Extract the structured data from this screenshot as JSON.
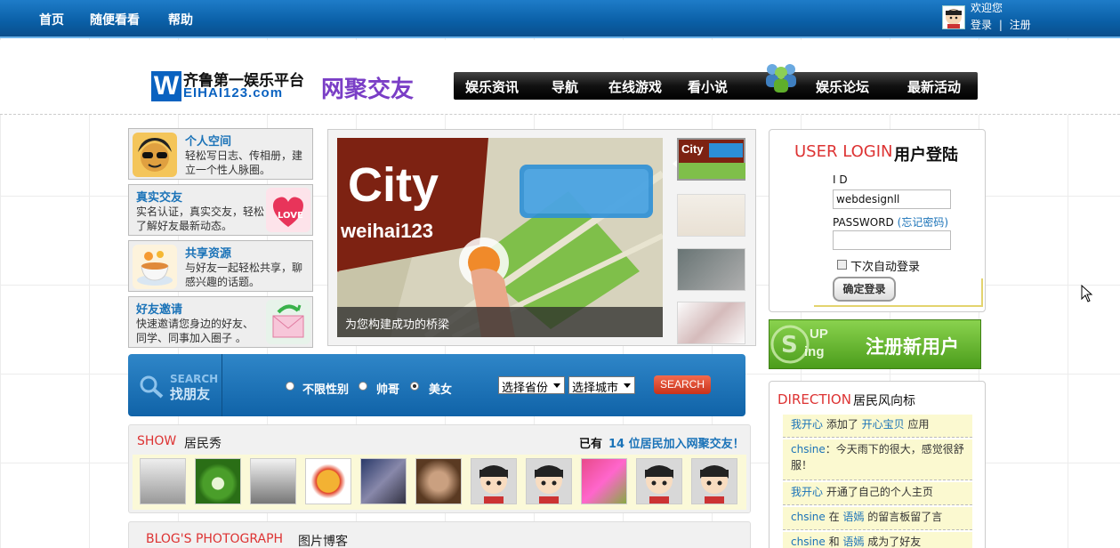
{
  "topbar": {
    "nav": [
      "首页",
      "随便看看",
      "帮助"
    ],
    "welcome": "欢迎您",
    "login_link": "登录",
    "separator": "|",
    "register_link": "注册"
  },
  "header": {
    "logo_mark": "W",
    "logo_cn": "齐鲁第一娱乐平台",
    "logo_en": "EIHAI123.com",
    "logo2": "网聚交友",
    "nav": [
      "娱乐资讯",
      "导航",
      "在线游戏",
      "看小说",
      "娱乐论坛",
      "最新活动"
    ]
  },
  "features": [
    {
      "title": "个人空间",
      "desc": "轻松写日志、传相册，建立一个性人脉圈。",
      "icon": "sunglasses-face-icon"
    },
    {
      "title": "真实交友",
      "desc": "实名认证，真实交友，轻松了解好友最新动态。",
      "icon": "love-heart-icon"
    },
    {
      "title": "共享资源",
      "desc": "与好友一起轻松共享，聊感兴趣的话题。",
      "icon": "tea-cup-icon"
    },
    {
      "title": "好友邀请",
      "desc": "快速邀请您身边的好友、同学、同事加入圈子 。",
      "icon": "invite-envelope-icon"
    }
  ],
  "slideshow": {
    "title_word": "City",
    "title_sub": "weihai123",
    "caption": "为您构建成功的桥梁"
  },
  "search": {
    "label_en": "SEARCH",
    "label_cn": "找朋友",
    "genders": [
      "不限性别",
      "帅哥",
      "美女"
    ],
    "selected_gender": "美女",
    "province": "选择省份",
    "city": "选择城市",
    "button": "SEARCH"
  },
  "show": {
    "title_en": "SHOW",
    "title_cn": "居民秀",
    "count_prefix": "已有",
    "count_text": "14 位居民加入网聚交友！"
  },
  "blog": {
    "title_en": "BLOG'S PHOTOGRAPH",
    "title_cn": "图片博客"
  },
  "login": {
    "title_en": "USER LOGIN",
    "title_cn": "用户登陆",
    "id_label": "I D",
    "id_value": "webdesignll",
    "password_label": "PASSWORD",
    "forgot": "(忘记密码)",
    "remember": "下次自动登录",
    "submit": "确定登录"
  },
  "register": {
    "label": "注册新用户",
    "logo_text_1": "UP",
    "logo_text_2": "ing"
  },
  "direction": {
    "title_en": "DIRECTION",
    "title_cn": "居民风向标",
    "items": [
      {
        "user": "我开心",
        "text": " 添加了 ",
        "target": "开心宝贝",
        "tail": " 应用"
      },
      {
        "user": "chsine",
        "text": "：今天雨下的很大，感觉很舒服！",
        "target": "",
        "tail": ""
      },
      {
        "user": "我开心",
        "text": " 开通了自己的个人主页",
        "target": "",
        "tail": ""
      },
      {
        "user": "chsine",
        "text": " 在 ",
        "target": "语嫣",
        "tail": " 的留言板留了言"
      },
      {
        "user": "chsine",
        "text": " 和 ",
        "target": "语嫣",
        "tail": " 成为了好友"
      }
    ]
  },
  "colors": {
    "topbar": "#0a5fa6",
    "accent_red": "#dd3333",
    "link_blue": "#1b73b8",
    "register_green": "#5aae25"
  }
}
